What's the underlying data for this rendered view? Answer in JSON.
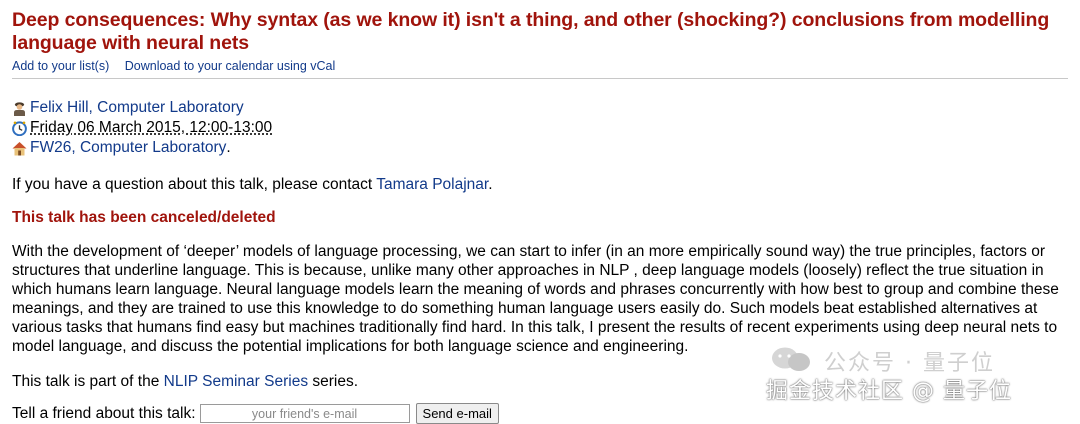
{
  "talk": {
    "title": "Deep consequences: Why syntax (as we know it) isn't a thing, and other (shocking?) conclusions from modelling language with neural nets"
  },
  "toolbar": {
    "add_list": "Add to your list(s)",
    "download_cal": "Download to your calendar using vCal"
  },
  "meta": {
    "speaker": "Felix Hill, Computer Laboratory",
    "datetime": "Friday 06 March 2015, 12:00-13:00",
    "venue": "FW26, Computer Laboratory",
    "venue_suffix": "."
  },
  "contact": {
    "prefix": "If you have a question about this talk, please contact ",
    "name": "Tamara Polajnar",
    "suffix": "."
  },
  "status": "This talk has been canceled/deleted",
  "abstract": "With the development of ‘deeper’ models of language processing, we can start to infer (in an more empirically sound way) the true principles, factors or structures that underline language. This is because, unlike many other approaches in NLP , deep language models (loosely) reflect the true situation in which humans learn language. Neural language models learn the meaning of words and phrases concurrently with how best to group and combine these meanings, and they are trained to use this knowledge to do something human language users easily do. Such models beat established alternatives at various tasks that humans find easy but machines traditionally find hard. In this talk, I present the results of recent experiments using deep neural nets to model language, and discuss the potential implications for both language science and engineering.",
  "series": {
    "prefix": "This talk is part of the ",
    "name": "NLIP Seminar Series",
    "suffix": " series."
  },
  "tell_friend": {
    "label": "Tell a friend about this talk:",
    "placeholder": "your friend's e-mail",
    "button": "Send e-mail"
  },
  "watermark": {
    "line1": "公众号 · 量子位",
    "line2": "掘金技术社区 @ 量子位"
  },
  "colors": {
    "title": "#a0140c",
    "link": "#123a8a"
  }
}
